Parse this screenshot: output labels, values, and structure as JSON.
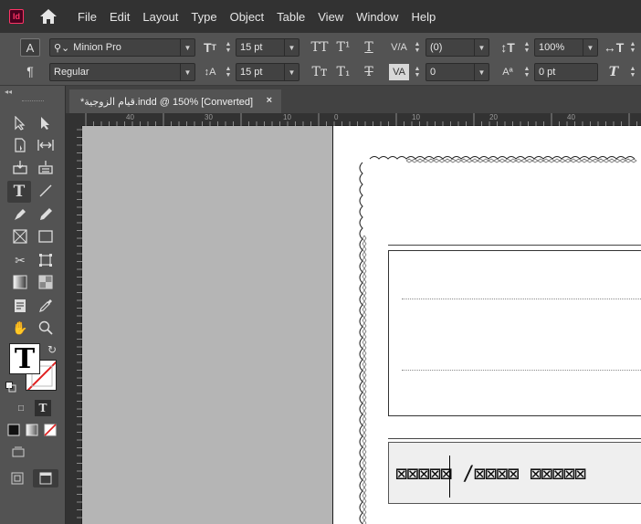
{
  "app": {
    "logo_text": "Id"
  },
  "menu": [
    "File",
    "Edit",
    "Layout",
    "Type",
    "Object",
    "Table",
    "View",
    "Window",
    "Help"
  ],
  "control": {
    "char_mode": "A",
    "para_mode": "¶",
    "font_family": "Minion Pro",
    "font_style": "Regular",
    "font_size": "15 pt",
    "leading": "15 pt",
    "kerning": "(0)",
    "tracking": "0",
    "vertical_scale": "100%",
    "baseline_shift": "0 pt",
    "allcaps_glyph": "TT",
    "superscript_glyph": "T¹",
    "underline_glyph": "T",
    "smallcaps_glyph": "Tт",
    "subscript_glyph": "T₁",
    "strike_glyph": "T"
  },
  "tab": {
    "title": "*قيام الزوجية.indd @ 150% [Converted]",
    "close": "×"
  },
  "ruler_h_labels": [
    "40",
    "30",
    "20",
    "10",
    "0",
    "10",
    "20",
    "30",
    "40",
    "50"
  ],
  "tools": {
    "fill_glyph": "T",
    "text_mode_glyph": "T"
  },
  "document": {
    "glyph_text": "⊠⊠⊠⊠⊠ /⊠⊠⊠⊠ ⊠⊠⊠⊠⊠"
  }
}
